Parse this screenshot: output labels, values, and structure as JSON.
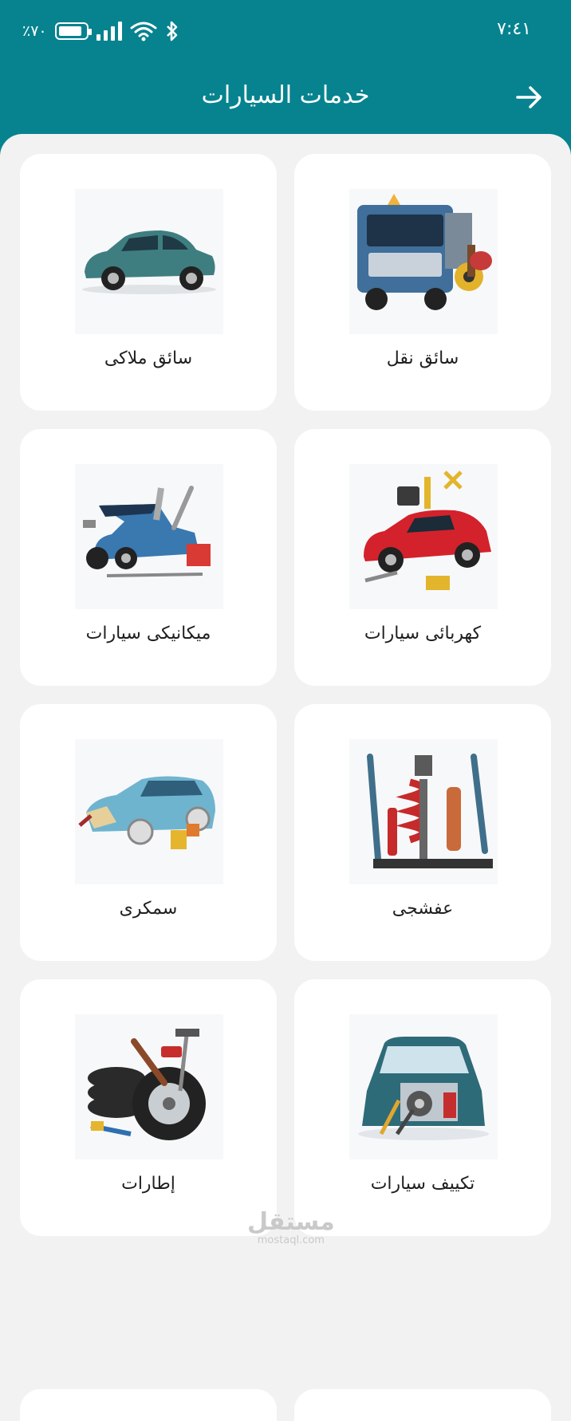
{
  "status_bar": {
    "time": "٧:٤١",
    "battery_percent": "٪٧٠",
    "icons": [
      "battery-icon",
      "signal-icon",
      "wifi-icon",
      "bluetooth-icon"
    ]
  },
  "header": {
    "title": "خدمات السيارات",
    "back_icon": "arrow-right-icon",
    "background_color": "#06838f"
  },
  "services": [
    {
      "label": "سائق نقل",
      "icon": "truck-tools-image"
    },
    {
      "label": "سائق ملاكى",
      "icon": "sedan-car-image"
    },
    {
      "label": "كهربائى سيارات",
      "icon": "car-electrician-image"
    },
    {
      "label": "ميكانيكى سيارات",
      "icon": "car-mechanic-image"
    },
    {
      "label": "عفشجى",
      "icon": "suspension-image"
    },
    {
      "label": "سمكرى",
      "icon": "bodywork-image"
    },
    {
      "label": "تكييف سيارات",
      "icon": "car-ac-image"
    },
    {
      "label": "إطارات",
      "icon": "tires-image"
    }
  ],
  "watermark": {
    "main": "مستقل",
    "sub": "mostaql.com"
  }
}
